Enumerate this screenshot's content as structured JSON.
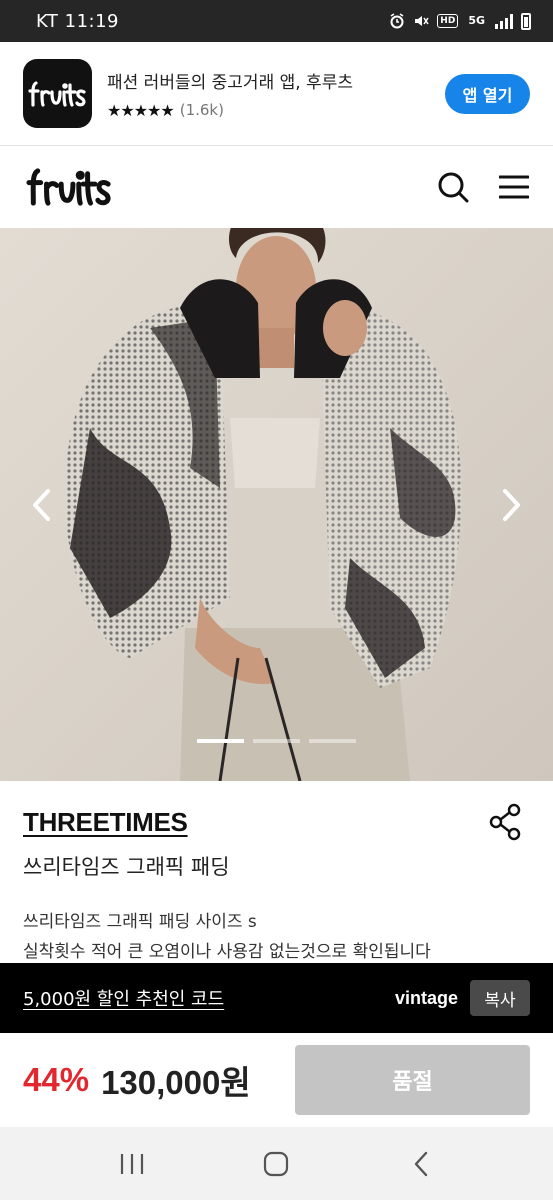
{
  "status_bar": {
    "carrier_time": "KT 11:19",
    "icons": [
      "alarm-icon",
      "mute-icon",
      "hd-icon",
      "5g-icon",
      "signal-icon",
      "battery-icon"
    ],
    "hd_label": "HD",
    "network_label": "5G"
  },
  "app_banner": {
    "title": "패션 러버들의 중고거래 앱, 후루츠",
    "stars": "★★★★★",
    "rating_count": "(1.6k)",
    "open_button": "앱 열기",
    "logo_text": "fruits"
  },
  "header": {
    "logo_text": "fruits",
    "icons": [
      "search-icon",
      "menu-icon"
    ]
  },
  "carousel": {
    "pages": 3,
    "active_index": 0
  },
  "product": {
    "brand": "THREETIMES",
    "name": "쓰리타임즈 그래픽 패딩",
    "description_line1": "쓰리타임즈 그래픽 패딩 사이즈 s",
    "description_line2": "실착횟수 적어 큰 오염이나 사용감 없는것으로 확인됩니다"
  },
  "promo": {
    "link_text": "5,000원 할인 추천인 코드",
    "code": "vintage",
    "copy_button": "복사"
  },
  "purchase": {
    "discount": "44%",
    "price": "130,000원",
    "status_button": "품절"
  },
  "colors": {
    "accent_blue": "#1684e8",
    "discount_red": "#e2272e",
    "soldout_gray": "#c4c4c4"
  }
}
